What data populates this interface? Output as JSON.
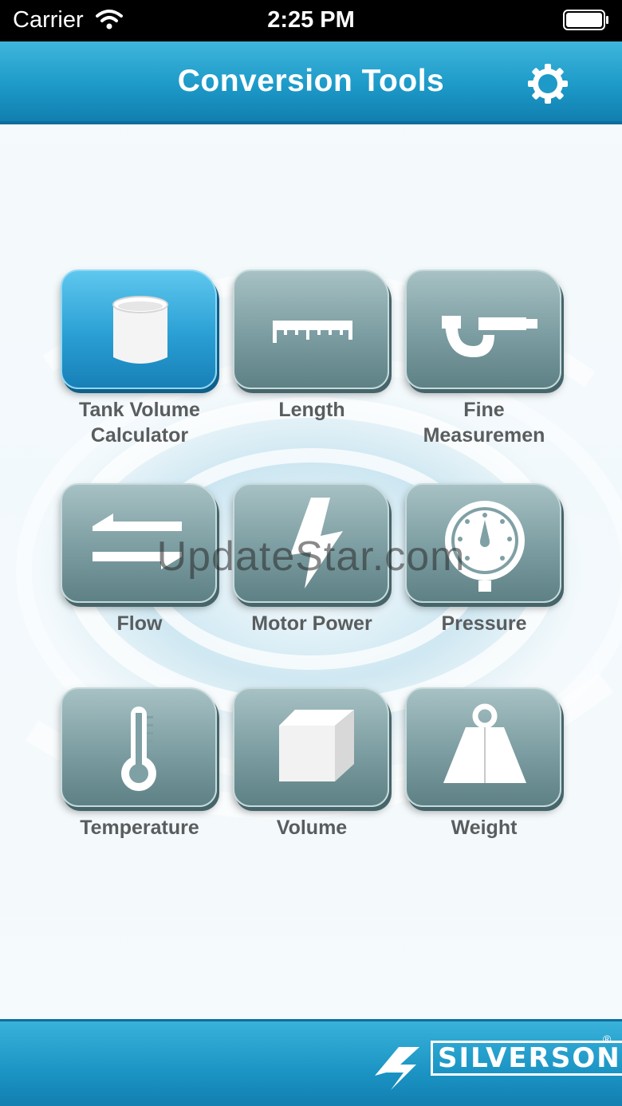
{
  "status_bar": {
    "carrier": "Carrier",
    "time": "2:25 PM"
  },
  "header": {
    "title": "Conversion Tools",
    "settings_icon": "gear-icon"
  },
  "tools": [
    {
      "label": "Tank Volume\nCalculator",
      "icon": "tank-icon",
      "active": true
    },
    {
      "label": "Length",
      "icon": "ruler-icon",
      "active": false
    },
    {
      "label": "Fine\nMeasuremen",
      "icon": "micrometer-icon",
      "active": false
    },
    {
      "label": "Flow",
      "icon": "flow-arrows-icon",
      "active": false
    },
    {
      "label": "Motor Power",
      "icon": "lightning-icon",
      "active": false
    },
    {
      "label": "Pressure",
      "icon": "pressure-gauge-icon",
      "active": false
    },
    {
      "label": "Temperature",
      "icon": "thermometer-icon",
      "active": false
    },
    {
      "label": "Volume",
      "icon": "cube-icon",
      "active": false
    },
    {
      "label": "Weight",
      "icon": "weight-icon",
      "active": false
    }
  ],
  "watermark": "UpdateStar.com",
  "footer": {
    "brand": "SILVERSON",
    "registered_mark": "®"
  },
  "colors": {
    "header_blue": "#1d9ac8",
    "active_tile": "#2a9fd4",
    "tile_gray": "#7fa0a4",
    "label_gray": "#5a5d5e"
  }
}
